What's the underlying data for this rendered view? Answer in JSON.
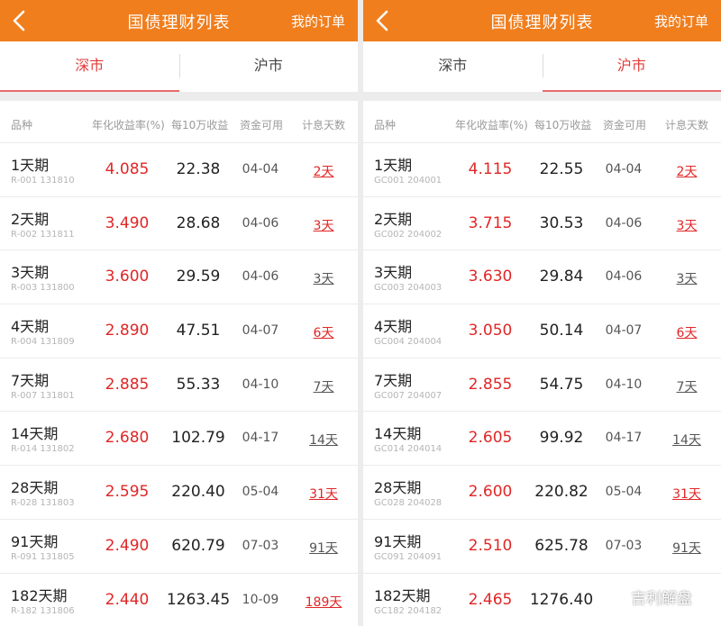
{
  "colors": {
    "header": "#f07e1d",
    "accent_red": "#e02626",
    "tab_active": "#e43a3a"
  },
  "panels": [
    {
      "header": {
        "title": "国债理财列表",
        "orders": "我的订单"
      },
      "tabs": [
        {
          "label": "深市",
          "active": true
        },
        {
          "label": "沪市",
          "active": false
        }
      ],
      "columns": {
        "name": "品种",
        "rate": "年化收益率(%)",
        "income": "每10万收益",
        "date": "资金可用",
        "days": "计息天数"
      },
      "rows": [
        {
          "name": "1天期",
          "code": "R-001 131810",
          "rate": "4.085",
          "income": "22.38",
          "date": "04-04",
          "days": "2天",
          "days_color": "red"
        },
        {
          "name": "2天期",
          "code": "R-002 131811",
          "rate": "3.490",
          "income": "28.68",
          "date": "04-06",
          "days": "3天",
          "days_color": "red"
        },
        {
          "name": "3天期",
          "code": "R-003 131800",
          "rate": "3.600",
          "income": "29.59",
          "date": "04-06",
          "days": "3天",
          "days_color": "gray"
        },
        {
          "name": "4天期",
          "code": "R-004 131809",
          "rate": "2.890",
          "income": "47.51",
          "date": "04-07",
          "days": "6天",
          "days_color": "red"
        },
        {
          "name": "7天期",
          "code": "R-007 131801",
          "rate": "2.885",
          "income": "55.33",
          "date": "04-10",
          "days": "7天",
          "days_color": "gray"
        },
        {
          "name": "14天期",
          "code": "R-014 131802",
          "rate": "2.680",
          "income": "102.79",
          "date": "04-17",
          "days": "14天",
          "days_color": "gray"
        },
        {
          "name": "28天期",
          "code": "R-028 131803",
          "rate": "2.595",
          "income": "220.40",
          "date": "05-04",
          "days": "31天",
          "days_color": "red"
        },
        {
          "name": "91天期",
          "code": "R-091 131805",
          "rate": "2.490",
          "income": "620.79",
          "date": "07-03",
          "days": "91天",
          "days_color": "gray"
        },
        {
          "name": "182天期",
          "code": "R-182 131806",
          "rate": "2.440",
          "income": "1263.45",
          "date": "10-09",
          "days": "189天",
          "days_color": "red"
        }
      ]
    },
    {
      "header": {
        "title": "国债理财列表",
        "orders": "我的订单"
      },
      "tabs": [
        {
          "label": "深市",
          "active": false
        },
        {
          "label": "沪市",
          "active": true
        }
      ],
      "columns": {
        "name": "品种",
        "rate": "年化收益率(%)",
        "income": "每10万收益",
        "date": "资金可用",
        "days": "计息天数"
      },
      "rows": [
        {
          "name": "1天期",
          "code": "GC001 204001",
          "rate": "4.115",
          "income": "22.55",
          "date": "04-04",
          "days": "2天",
          "days_color": "red"
        },
        {
          "name": "2天期",
          "code": "GC002 204002",
          "rate": "3.715",
          "income": "30.53",
          "date": "04-06",
          "days": "3天",
          "days_color": "red"
        },
        {
          "name": "3天期",
          "code": "GC003 204003",
          "rate": "3.630",
          "income": "29.84",
          "date": "04-06",
          "days": "3天",
          "days_color": "gray"
        },
        {
          "name": "4天期",
          "code": "GC004 204004",
          "rate": "3.050",
          "income": "50.14",
          "date": "04-07",
          "days": "6天",
          "days_color": "red"
        },
        {
          "name": "7天期",
          "code": "GC007 204007",
          "rate": "2.855",
          "income": "54.75",
          "date": "04-10",
          "days": "7天",
          "days_color": "gray"
        },
        {
          "name": "14天期",
          "code": "GC014 204014",
          "rate": "2.605",
          "income": "99.92",
          "date": "04-17",
          "days": "14天",
          "days_color": "gray"
        },
        {
          "name": "28天期",
          "code": "GC028 204028",
          "rate": "2.600",
          "income": "220.82",
          "date": "05-04",
          "days": "31天",
          "days_color": "red"
        },
        {
          "name": "91天期",
          "code": "GC091 204091",
          "rate": "2.510",
          "income": "625.78",
          "date": "07-03",
          "days": "91天",
          "days_color": "gray"
        },
        {
          "name": "182天期",
          "code": "GC182 204182",
          "rate": "2.465",
          "income": "1276.40",
          "date": "",
          "days": "",
          "days_color": "red"
        }
      ]
    }
  ],
  "watermark": {
    "text": "吉利解盘",
    "icon": "wechat-icon"
  }
}
